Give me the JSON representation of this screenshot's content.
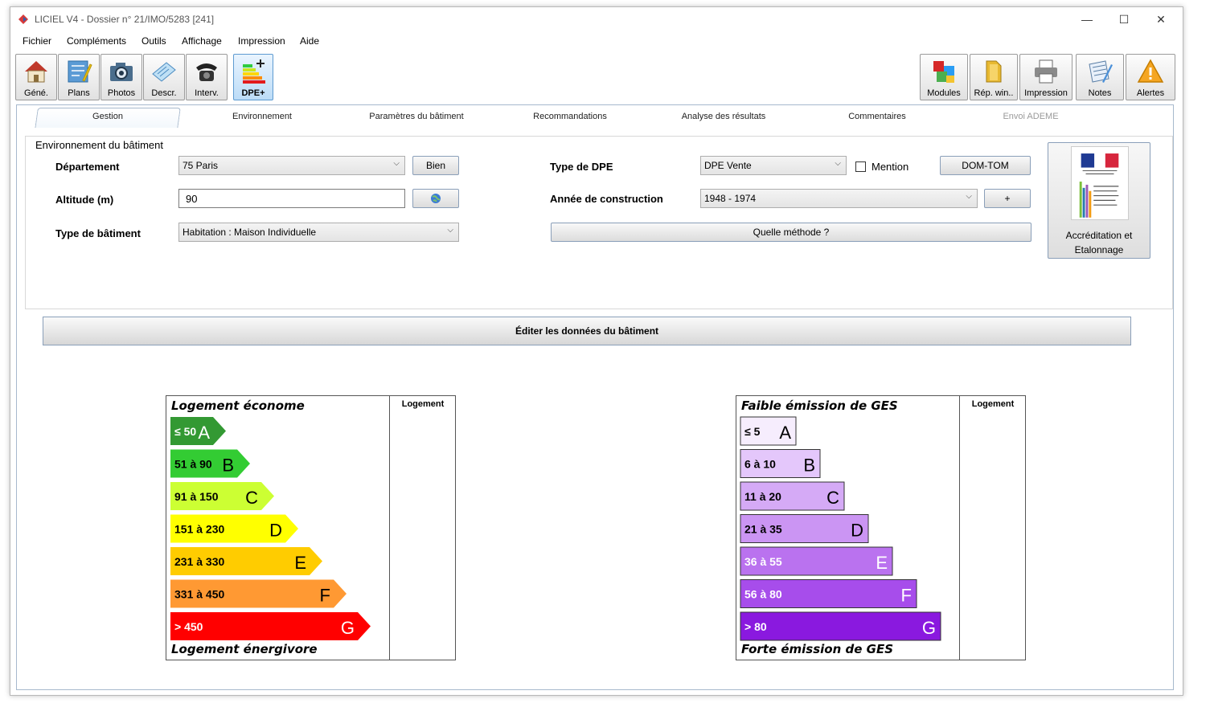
{
  "window": {
    "title": "LICIEL V4 - Dossier n° 21/IMO/5283 [241]",
    "controls": {
      "minimize": "—",
      "maximize": "☐",
      "close": "✕"
    }
  },
  "menu": [
    "Fichier",
    "Compléments",
    "Outils",
    "Affichage",
    "Impression",
    "Aide"
  ],
  "toolbar_left": [
    {
      "label": "Géné.",
      "icon": "house-icon"
    },
    {
      "label": "Plans",
      "icon": "plans-icon"
    },
    {
      "label": "Photos",
      "icon": "camera-icon"
    },
    {
      "label": "Descr.",
      "icon": "description-icon"
    },
    {
      "label": "Interv.",
      "icon": "phone-icon"
    },
    {
      "label": "DPE+",
      "icon": "dpe-icon"
    }
  ],
  "toolbar_right": [
    {
      "label": "Modules",
      "icon": "puzzle-icon"
    },
    {
      "label": "Rép. win..",
      "icon": "folder-icon"
    },
    {
      "label": "Impression",
      "icon": "printer-icon"
    },
    {
      "label": "Notes",
      "icon": "notes-icon"
    },
    {
      "label": "Alertes",
      "icon": "warning-icon"
    }
  ],
  "tabs": [
    "Gestion",
    "Environnement",
    "Paramètres du bâtiment",
    "Recommandations",
    "Analyse des résultats",
    "Commentaires",
    "Envoi ADEME"
  ],
  "env": {
    "group_title": "Environnement du bâtiment",
    "departement_label": "Département",
    "departement_value": "75  Paris",
    "bien_button": "Bien",
    "altitude_label": "Altitude (m)",
    "altitude_value": "90",
    "type_batiment_label": "Type de bâtiment",
    "type_batiment_value": "Habitation : Maison Individuelle",
    "type_dpe_label": "Type de DPE",
    "type_dpe_value": "DPE Vente",
    "mention_label": "Mention",
    "domtom_button": "DOM-TOM",
    "annee_label": "Année de construction",
    "annee_value": "1948 - 1974",
    "plus_button": "+",
    "methode_button": "Quelle méthode ?",
    "accreditation_line1": "Accréditation et",
    "accreditation_line2": "Etalonnage"
  },
  "edit_button": "Éditer les données du bâtiment",
  "energy_label": {
    "top": "Logement économe",
    "bottom": "Logement énergivore",
    "column": "Logement",
    "classes": [
      {
        "range": "≤ 50",
        "letter": "A",
        "color": "#339933"
      },
      {
        "range": "51 à 90",
        "letter": "B",
        "color": "#33cc33"
      },
      {
        "range": "91 à 150",
        "letter": "C",
        "color": "#ccff33"
      },
      {
        "range": "151 à 230",
        "letter": "D",
        "color": "#ffff00"
      },
      {
        "range": "231 à 330",
        "letter": "E",
        "color": "#ffcc00"
      },
      {
        "range": "331 à 450",
        "letter": "F",
        "color": "#ff9933"
      },
      {
        "range": "> 450",
        "letter": "G",
        "color": "#ff0000"
      }
    ]
  },
  "ges_label": {
    "top": "Faible émission de GES",
    "bottom": "Forte émission de GES",
    "column": "Logement",
    "classes": [
      {
        "range": "≤ 5",
        "letter": "A",
        "color": "#f6edfd"
      },
      {
        "range": "6 à 10",
        "letter": "B",
        "color": "#e4c7fb"
      },
      {
        "range": "11 à 20",
        "letter": "C",
        "color": "#d5aaf6"
      },
      {
        "range": "21 à 35",
        "letter": "D",
        "color": "#cb95f3"
      },
      {
        "range": "36 à 55",
        "letter": "E",
        "color": "#ba72ef"
      },
      {
        "range": "56 à 80",
        "letter": "F",
        "color": "#a74deb"
      },
      {
        "range": "> 80",
        "letter": "G",
        "color": "#8a19df"
      }
    ]
  }
}
